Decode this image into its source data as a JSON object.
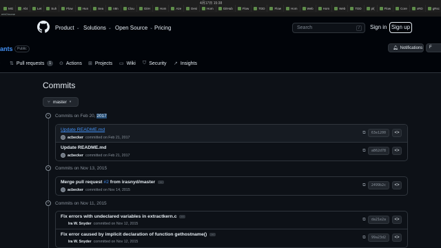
{
  "browser": {
    "title": "4月17日 15:38",
    "url_text": "erbChrome",
    "tabs": [
      "MG",
      "Abt",
      "Let",
      "Suh",
      "Flow",
      "Hun",
      "Sea",
      "n8n",
      "Clou",
      "GitH",
      "Hom",
      "Aze",
      "Desi",
      "Hom",
      "GitHub",
      "Flow",
      "TDD",
      "Flow",
      "Hom",
      "Web",
      "Hom",
      "Web",
      "TDD",
      "pl(",
      "Flow",
      "Core",
      "xRD",
      "gRsc",
      "Sea",
      "DMA",
      "Flow"
    ]
  },
  "header": {
    "nav": [
      "Product",
      "Solutions",
      "Open Source",
      "Pricing"
    ],
    "search_placeholder": "Search",
    "search_shortcut": "/",
    "sign_in": "Sign in",
    "sign_up": "Sign up"
  },
  "repo": {
    "name": "ants",
    "visibility": "Public",
    "notifications": "Notifications",
    "fork": "F",
    "tabs": [
      {
        "label": "Pull requests",
        "icon": "pull-request-icon",
        "count": "1"
      },
      {
        "label": "Actions",
        "icon": "play-icon"
      },
      {
        "label": "Projects",
        "icon": "table-icon"
      },
      {
        "label": "Wiki",
        "icon": "book-icon"
      },
      {
        "label": "Security",
        "icon": "shield-icon"
      },
      {
        "label": "Insights",
        "icon": "graph-icon"
      }
    ]
  },
  "page": {
    "title": "Commits",
    "branch": "master"
  },
  "groups": [
    {
      "date_prefix": "Commits on Feb 20, ",
      "date_year": "2017",
      "commits": [
        {
          "message": "Update README.md",
          "author": "acbecker",
          "meta": "committed on Feb 21, 2017",
          "sha": "63e1200"
        },
        {
          "message": "Update README.md",
          "author": "acbecker",
          "meta": "committed on Feb 21, 2017",
          "sha": "a862d78"
        }
      ]
    },
    {
      "date_prefix": "Commits on Nov 13, 2015",
      "date_year": "",
      "commits": [
        {
          "message": "Merge pull request ",
          "pr": "#2",
          "message_suffix": " from irasnyd/master",
          "author": "acbecker",
          "meta": "committed on Nov 14, 2015",
          "sha": "2499b2c"
        }
      ]
    },
    {
      "date_prefix": "Commits on Nov 11, 2015",
      "date_year": "",
      "commits": [
        {
          "message": "Fix errors with undeclared variables in extractkern.c",
          "author": "Ira W. Snyder",
          "meta": "committed on Nov 12, 2015",
          "sha": "da21e2a"
        },
        {
          "message": "Fix error caused by implicit declaration of function gethostname()",
          "author": "Ira W. Snyder",
          "meta": "committed on Nov 12, 2015",
          "sha": "99a23d2"
        }
      ]
    }
  ],
  "colors": {
    "background": "#0d1117",
    "header": "#010409",
    "link": "#4493f8",
    "border": "#30363d"
  }
}
